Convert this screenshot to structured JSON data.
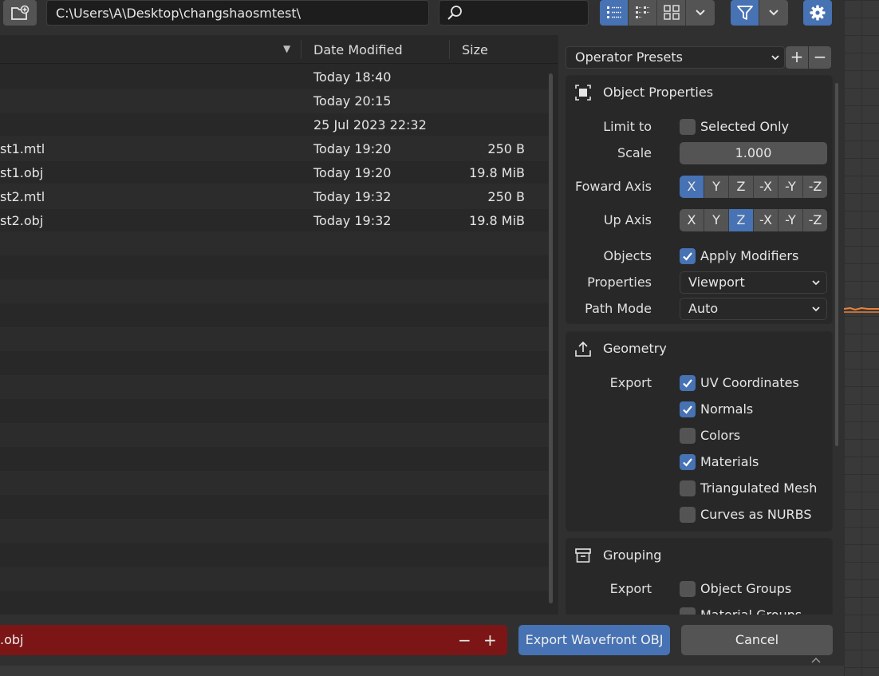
{
  "toolbar": {
    "path": "C:\\Users\\A\\Desktop\\changshaosmtest\\",
    "search_placeholder": "",
    "icons": [
      "new-folder-icon",
      "search-icon",
      "vertical-list-icon",
      "horizontal-list-icon",
      "thumbnails-icon",
      "chevron-down-icon",
      "filter-icon",
      "gear-icon"
    ]
  },
  "file_list": {
    "columns": {
      "date": "Date Modified",
      "size": "Size"
    },
    "rows": [
      {
        "name": "",
        "date": "Today 18:40",
        "size": ""
      },
      {
        "name": "",
        "date": "Today 20:15",
        "size": ""
      },
      {
        "name": "",
        "date": "25 Jul 2023 22:32",
        "size": ""
      },
      {
        "name": "st1.mtl",
        "date": "Today 19:20",
        "size": "250 B"
      },
      {
        "name": "st1.obj",
        "date": "Today 19:20",
        "size": "19.8 MiB"
      },
      {
        "name": "st2.mtl",
        "date": "Today 19:32",
        "size": "250 B"
      },
      {
        "name": "st2.obj",
        "date": "Today 19:32",
        "size": "19.8 MiB"
      }
    ]
  },
  "sidebar": {
    "presets_label": "Operator Presets",
    "add_label": "+",
    "remove_label": "−",
    "object_properties": {
      "title": "Object Properties",
      "limit_to_label": "Limit to",
      "selected_only_label": "Selected Only",
      "selected_only_checked": false,
      "scale_label": "Scale",
      "scale_value": "1.000",
      "forward_axis_label": "Foward Axis",
      "forward_axis_options": [
        "X",
        "Y",
        "Z",
        "-X",
        "-Y",
        "-Z"
      ],
      "forward_axis_selected": "X",
      "up_axis_label": "Up Axis",
      "up_axis_options": [
        "X",
        "Y",
        "Z",
        "-X",
        "-Y",
        "-Z"
      ],
      "up_axis_selected": "Z",
      "objects_label": "Objects",
      "apply_modifiers_label": "Apply Modifiers",
      "apply_modifiers_checked": true,
      "properties_label": "Properties",
      "properties_value": "Viewport",
      "path_mode_label": "Path Mode",
      "path_mode_value": "Auto"
    },
    "geometry": {
      "title": "Geometry",
      "export_label": "Export",
      "options": [
        {
          "label": "UV Coordinates",
          "checked": true
        },
        {
          "label": "Normals",
          "checked": true
        },
        {
          "label": "Colors",
          "checked": false
        },
        {
          "label": "Materials",
          "checked": true
        },
        {
          "label": "Triangulated Mesh",
          "checked": false
        },
        {
          "label": "Curves as NURBS",
          "checked": false
        }
      ]
    },
    "grouping": {
      "title": "Grouping",
      "export_label": "Export",
      "options": [
        {
          "label": "Object Groups",
          "checked": false
        },
        {
          "label": "Material Groups",
          "checked": false
        }
      ]
    }
  },
  "bottom": {
    "filename": ".obj",
    "decrement_label": "−",
    "increment_label": "+",
    "export_label": "Export Wavefront OBJ",
    "cancel_label": "Cancel"
  },
  "colors": {
    "accent": "#4772b3",
    "filename_error_bg": "#7c1616",
    "button_bg": "#545454",
    "panel_bg": "#282828",
    "window_bg": "#303030"
  }
}
